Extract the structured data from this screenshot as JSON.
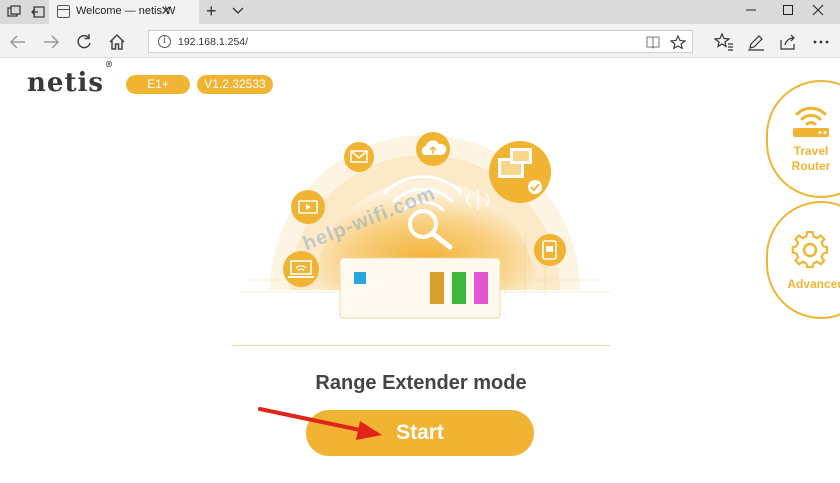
{
  "browser": {
    "tab_title": "Welcome — netis Wirel",
    "address": "192.168.1.254/"
  },
  "header": {
    "logo": "netis",
    "logo_mark": "®",
    "model": "E1+",
    "version": "V1.2.32533"
  },
  "main": {
    "mode_title": "Range Extender mode",
    "start_label": "Start"
  },
  "side": {
    "travel_router": [
      "Travel",
      "Router"
    ],
    "advanced": "Advanced"
  },
  "watermark": "help-wifi.com",
  "colors": {
    "accent": "#f0b432",
    "arrow": "#e3241b"
  },
  "icons": [
    "tab-actions-icon",
    "back-tabs-icon",
    "page-icon",
    "close-icon",
    "plus-icon",
    "chevron-down-icon",
    "minimize-icon",
    "maximize-icon",
    "close-window-icon",
    "back-icon",
    "forward-icon",
    "refresh-icon",
    "home-icon",
    "info-icon",
    "reading-view-icon",
    "favorite-star-icon",
    "favorites-icon",
    "pen-icon",
    "share-icon",
    "more-icon",
    "router-icon",
    "gear-icon",
    "mail-icon",
    "cloud-icon",
    "video-icon",
    "laptop-wifi-icon",
    "devices-icon",
    "phone-icon",
    "wifi-icon",
    "magnifier-icon",
    "extender-device-icon"
  ]
}
